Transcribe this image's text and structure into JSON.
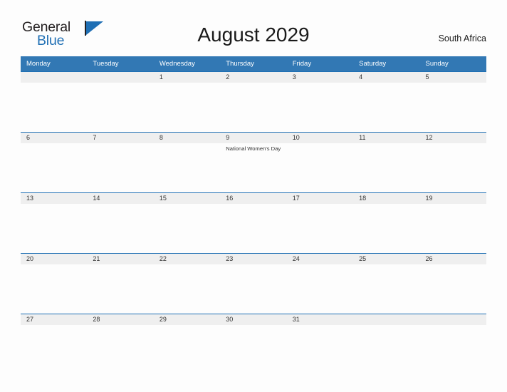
{
  "brand": {
    "name_top": "General",
    "name_bottom": "Blue",
    "flag_icon": "flag-icon",
    "accent_color": "#1f6fb4"
  },
  "header": {
    "title": "August 2029",
    "region": "South Africa"
  },
  "calendar": {
    "weekday_headers": [
      "Monday",
      "Tuesday",
      "Wednesday",
      "Thursday",
      "Friday",
      "Saturday",
      "Sunday"
    ],
    "header_bg_color": "#3278b4",
    "header_text_color": "#ffffff",
    "date_band_color": "#efefef",
    "rule_color": "#1f6fb4",
    "weeks": [
      {
        "days": [
          {
            "num": "",
            "event": ""
          },
          {
            "num": "",
            "event": ""
          },
          {
            "num": "1",
            "event": ""
          },
          {
            "num": "2",
            "event": ""
          },
          {
            "num": "3",
            "event": ""
          },
          {
            "num": "4",
            "event": ""
          },
          {
            "num": "5",
            "event": ""
          }
        ]
      },
      {
        "days": [
          {
            "num": "6",
            "event": ""
          },
          {
            "num": "7",
            "event": ""
          },
          {
            "num": "8",
            "event": ""
          },
          {
            "num": "9",
            "event": "National Women's Day"
          },
          {
            "num": "10",
            "event": ""
          },
          {
            "num": "11",
            "event": ""
          },
          {
            "num": "12",
            "event": ""
          }
        ]
      },
      {
        "days": [
          {
            "num": "13",
            "event": ""
          },
          {
            "num": "14",
            "event": ""
          },
          {
            "num": "15",
            "event": ""
          },
          {
            "num": "16",
            "event": ""
          },
          {
            "num": "17",
            "event": ""
          },
          {
            "num": "18",
            "event": ""
          },
          {
            "num": "19",
            "event": ""
          }
        ]
      },
      {
        "days": [
          {
            "num": "20",
            "event": ""
          },
          {
            "num": "21",
            "event": ""
          },
          {
            "num": "22",
            "event": ""
          },
          {
            "num": "23",
            "event": ""
          },
          {
            "num": "24",
            "event": ""
          },
          {
            "num": "25",
            "event": ""
          },
          {
            "num": "26",
            "event": ""
          }
        ]
      },
      {
        "days": [
          {
            "num": "27",
            "event": ""
          },
          {
            "num": "28",
            "event": ""
          },
          {
            "num": "29",
            "event": ""
          },
          {
            "num": "30",
            "event": ""
          },
          {
            "num": "31",
            "event": ""
          },
          {
            "num": "",
            "event": ""
          },
          {
            "num": "",
            "event": ""
          }
        ]
      }
    ]
  }
}
